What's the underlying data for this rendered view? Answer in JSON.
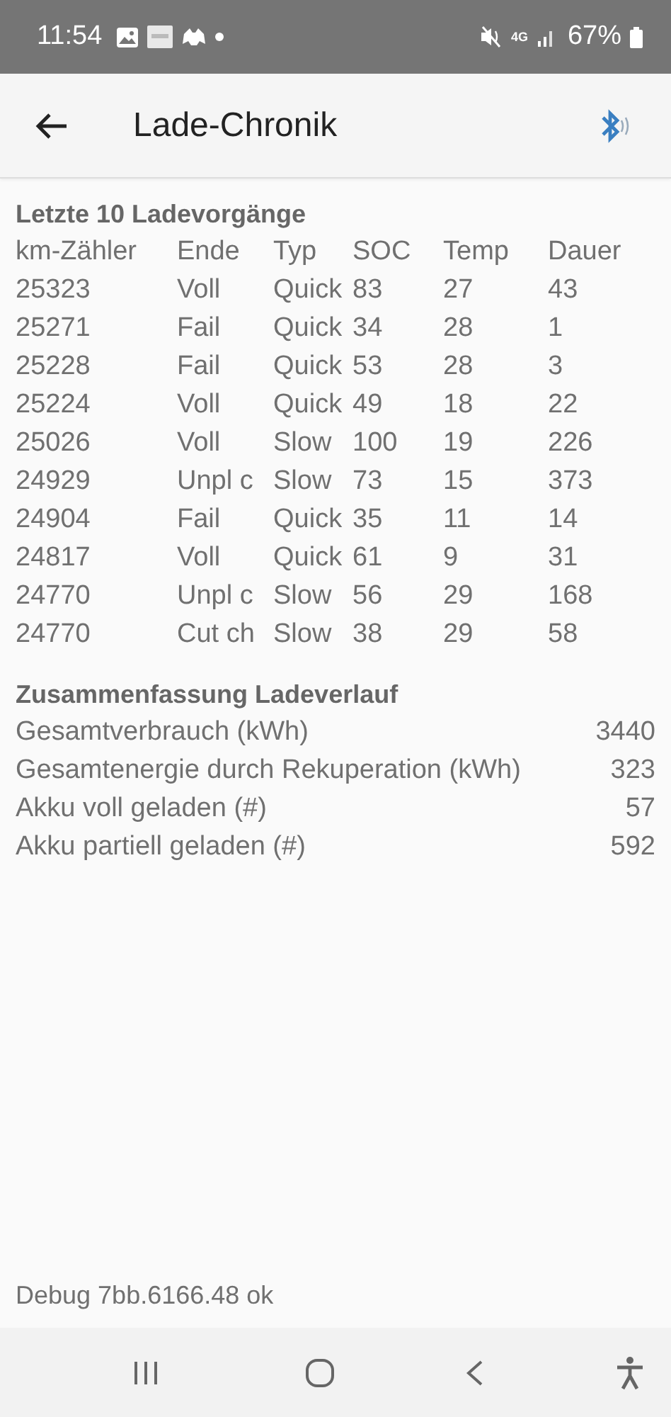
{
  "status_bar": {
    "time": "11:54",
    "network": "4G",
    "battery": "67%"
  },
  "app_bar": {
    "title": "Lade-Chronik"
  },
  "history": {
    "title": "Letzte 10 Ladevorgänge",
    "columns": [
      "km-Zähler",
      "Ende",
      "Typ",
      "SOC",
      "Temp",
      "Dauer"
    ],
    "rows": [
      [
        "25323",
        "Voll",
        "Quick",
        "83",
        "27",
        "43"
      ],
      [
        "25271",
        "Fail",
        "Quick",
        "34",
        "28",
        "1"
      ],
      [
        "25228",
        "Fail",
        "Quick",
        "53",
        "28",
        "3"
      ],
      [
        "25224",
        "Voll",
        "Quick",
        "49",
        "18",
        "22"
      ],
      [
        "25026",
        "Voll",
        "Slow",
        "100",
        "19",
        "226"
      ],
      [
        "24929",
        "Unpl c",
        "Slow",
        "73",
        "15",
        "373"
      ],
      [
        "24904",
        "Fail",
        "Quick",
        "35",
        "11",
        "14"
      ],
      [
        "24817",
        "Voll",
        "Quick",
        "61",
        "9",
        "31"
      ],
      [
        "24770",
        "Unpl c",
        "Slow",
        "56",
        "29",
        "168"
      ],
      [
        "24770",
        "Cut ch",
        "Slow",
        "38",
        "29",
        "58"
      ]
    ]
  },
  "summary": {
    "title": "Zusammenfassung Ladeverlauf",
    "rows": [
      {
        "label": "Gesamtverbrauch (kWh)",
        "value": "3440"
      },
      {
        "label": "Gesamtenergie durch Rekuperation (kWh)",
        "value": "323"
      },
      {
        "label": "Akku voll geladen (#)",
        "value": "57"
      },
      {
        "label": "Akku partiell geladen (#)",
        "value": "592"
      }
    ]
  },
  "footer": {
    "debug": "Debug 7bb.6166.48 ok"
  }
}
